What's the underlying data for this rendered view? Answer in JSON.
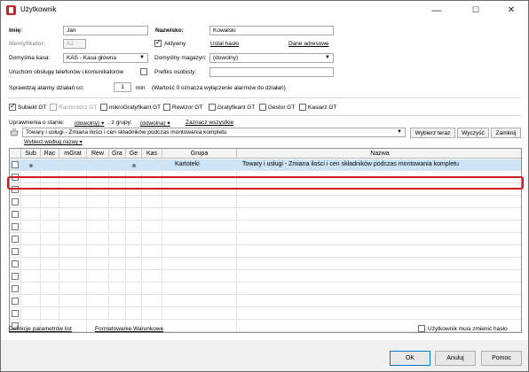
{
  "window": {
    "title": "Użytkownik",
    "controls": {
      "minimize": "—",
      "maximize": "☐",
      "close": "✕"
    }
  },
  "form": {
    "imie_label": "Imię:",
    "imie_value": "Jan",
    "nazwisko_label": "Nazwisko:",
    "nazwisko_value": "Kowalski",
    "identyfikator_label": "Identyfikator:",
    "identyfikator_value": "AJ",
    "aktywny_label": "Aktywny",
    "ustal_haslo": "Ustal hasło",
    "dane_adresowe": "Dane adresowe",
    "kasa_label": "Domyślna kasa:",
    "kasa_value": "KAS - Kasa główna",
    "magazyn_label": "Domyślny magazyn:",
    "magazyn_value": "(dowolny)",
    "telefony_label": "Uruchom obsługę telefonów i komunikatorów",
    "prefiks_label": "Prefiks osobisty:",
    "alarmy_label": "Sprawdzaj alarmy działań co:",
    "alarmy_value": "1",
    "alarmy_unit": "min",
    "alarmy_note": "(Wartość 0 oznacza wyłączenie alarmów do działań)"
  },
  "modules": [
    {
      "label": "Subiekt GT",
      "checked": true,
      "disabled": false
    },
    {
      "label": "Rachmistrz GT",
      "checked": false,
      "disabled": true
    },
    {
      "label": "mikroGratyfikant GT",
      "checked": false,
      "disabled": false
    },
    {
      "label": "Rewizor GT",
      "checked": false,
      "disabled": false
    },
    {
      "label": "Gratyfikant GT",
      "checked": false,
      "disabled": false
    },
    {
      "label": "Gestor GT",
      "checked": false,
      "disabled": false
    },
    {
      "label": "Kasiarz GT",
      "checked": false,
      "disabled": false
    }
  ],
  "permissions": {
    "state_label": "Uprawnienia o stanie:",
    "state_value": "(dowolny)",
    "group_label": ", z grupy:",
    "group_value": "(dowolna)",
    "select_all": "Zaznacz wszystkie",
    "search_value": "Towary i usługi - Zmiana ilości i cen składników podczas montowania kompletu",
    "choose_by_name": "Wybierz według nazwy",
    "btn_choose_now": "Wybierz teraz",
    "btn_clear": "Wyczyść",
    "btn_close": "Zamknij"
  },
  "grid": {
    "columns": [
      "Sub",
      "Rac",
      "mGrat",
      "Rew",
      "Gra",
      "Ge",
      "Kas",
      "Grupa",
      "Nazwa"
    ],
    "rows": [
      {
        "sub": true,
        "ge": true,
        "grupa": "Kartoteki",
        "nazwa": "Towary i usługi - Zmiana ilości i cen składników podczas montowania kompletu"
      }
    ]
  },
  "footer": {
    "link_definitions": "Definicje parametrów list",
    "link_formatting": "Formatowanie Warunkowe",
    "must_change_password": "Użytkownik musi zmienić hasło",
    "ok": "OK",
    "cancel": "Anuluj",
    "help": "Pomoc"
  },
  "colors": {
    "accent": "#0078d7",
    "selection_row": "#cde4f7",
    "highlight_border": "#d21c1c"
  }
}
